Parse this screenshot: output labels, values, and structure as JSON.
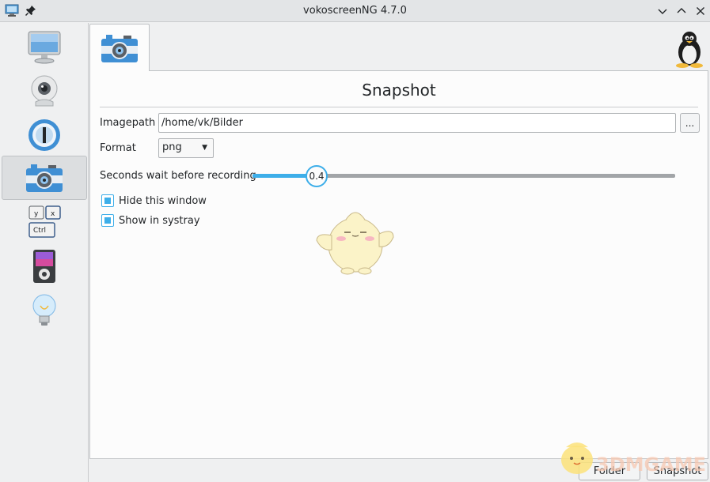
{
  "window": {
    "title": "vokoscreenNG 4.7.0"
  },
  "sidebar": {
    "items": [
      {
        "icon": "monitor-icon",
        "name": "Screencast"
      },
      {
        "icon": "webcam-icon",
        "name": "Camera"
      },
      {
        "icon": "player-icon",
        "name": "Player"
      },
      {
        "icon": "camera-icon",
        "name": "Snapshot",
        "selected": true
      },
      {
        "icon": "keyboard-keys-icon",
        "name": "Keys"
      },
      {
        "icon": "media-player-icon",
        "name": "Media"
      },
      {
        "icon": "lightbulb-icon",
        "name": "Info"
      }
    ]
  },
  "tab": {
    "icon": "camera-icon"
  },
  "snapshot": {
    "title": "Snapshot",
    "imagepath_label": "Imagepath",
    "imagepath_value": "/home/vk/Bilder",
    "browse_label": "...",
    "format_label": "Format",
    "format_value": "png",
    "wait_label": "Seconds wait before recording",
    "wait_value": "0.4",
    "hide_window_label": "Hide this window",
    "hide_window_checked": true,
    "systray_label": "Show in systray",
    "systray_checked": true
  },
  "buttons": {
    "folder": "Folder",
    "snapshot": "Snapshot"
  },
  "colors": {
    "accent": "#3daee9",
    "slider_track": "#a2a5a8"
  }
}
